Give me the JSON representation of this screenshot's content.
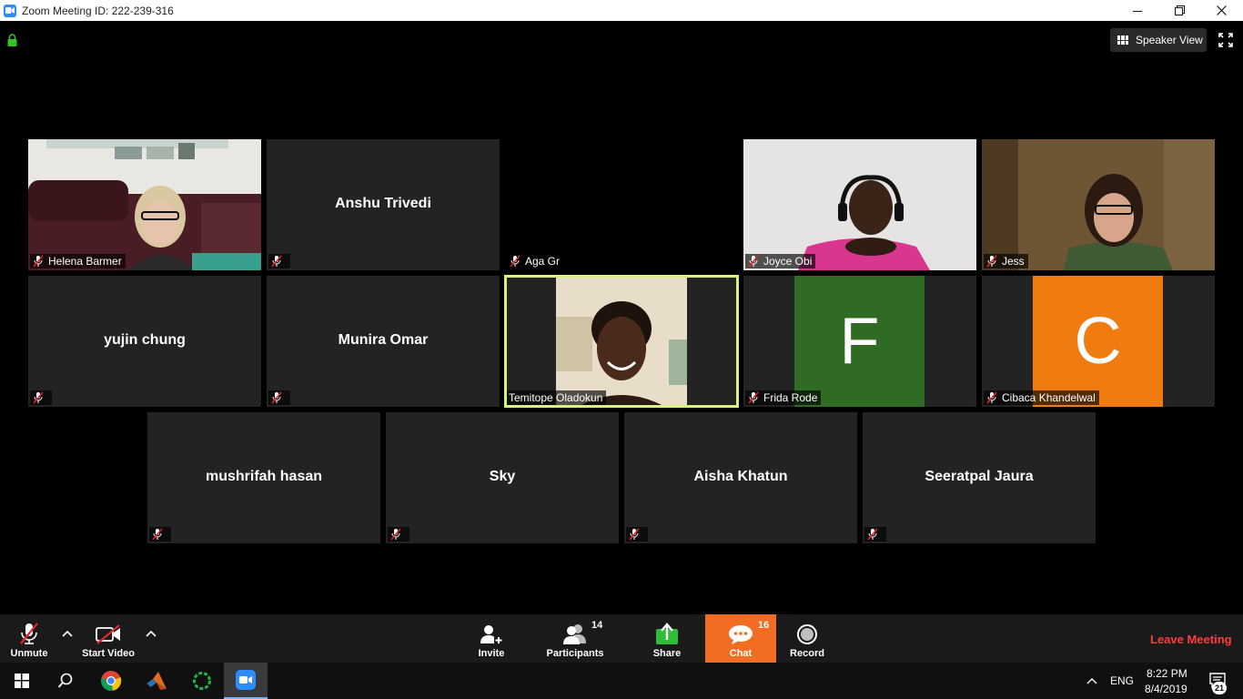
{
  "window": {
    "title": "Zoom Meeting ID: 222-239-316"
  },
  "header": {
    "speaker_view_label": "Speaker View"
  },
  "participants": [
    {
      "name": "Helena Barmer"
    },
    {
      "name": "Anshu Trivedi"
    },
    {
      "name": "Aga Gr"
    },
    {
      "name": "Joyce Obi"
    },
    {
      "name": "Jess"
    },
    {
      "name": "yujin chung"
    },
    {
      "name": "Munira Omar"
    },
    {
      "name": "Temitope Oladokun"
    },
    {
      "name": "Frida Rode",
      "initial": "F",
      "avatar_color": "#2f6b22"
    },
    {
      "name": "Cibaca Khandelwal",
      "initial": "C",
      "avatar_color": "#f07c0f"
    },
    {
      "name": "mushrifah hasan"
    },
    {
      "name": "Sky"
    },
    {
      "name": "Aisha Khatun"
    },
    {
      "name": "Seeratpal Jaura"
    }
  ],
  "toolbar": {
    "unmute_label": "Unmute",
    "start_video_label": "Start Video",
    "invite_label": "Invite",
    "participants_label": "Participants",
    "participants_count": "14",
    "share_label": "Share",
    "chat_label": "Chat",
    "chat_count": "16",
    "record_label": "Record",
    "leave_label": "Leave Meeting"
  },
  "taskbar": {
    "language": "ENG",
    "time": "8:22 PM",
    "date": "8/4/2019",
    "notification_count": "21"
  },
  "colors": {
    "accent": "#f26d21",
    "leave": "#ff3b3b",
    "active_speaker": "#d9f27a"
  }
}
